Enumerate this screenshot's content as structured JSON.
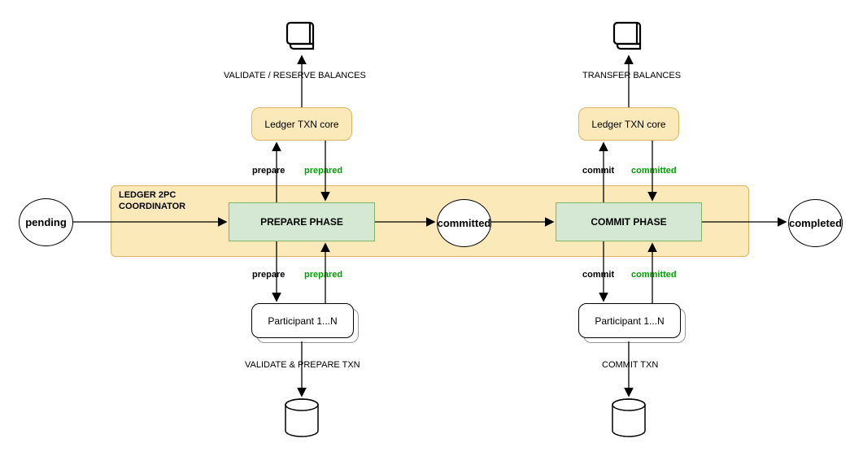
{
  "states": {
    "pending": "pending",
    "committed": "committed",
    "completed": "completed"
  },
  "coordinator": {
    "label_line1": "LEDGER 2PC",
    "label_line2": "COORDINATOR"
  },
  "phases": {
    "prepare": "PREPARE PHASE",
    "commit": "COMMIT PHASE"
  },
  "txncore": {
    "label": "Ledger TXN core"
  },
  "participant": {
    "label": "Participant 1...N"
  },
  "annotations": {
    "validate_reserve": "VALIDATE / RESERVE BALANCES",
    "transfer": "TRANSFER BALANCES",
    "validate_prepare": "VALIDATE & PREPARE TXN",
    "commit_txn": "COMMIT TXN"
  },
  "msgs": {
    "prepare": "prepare",
    "prepared": "prepared",
    "commit": "commit",
    "committed": "committed"
  }
}
